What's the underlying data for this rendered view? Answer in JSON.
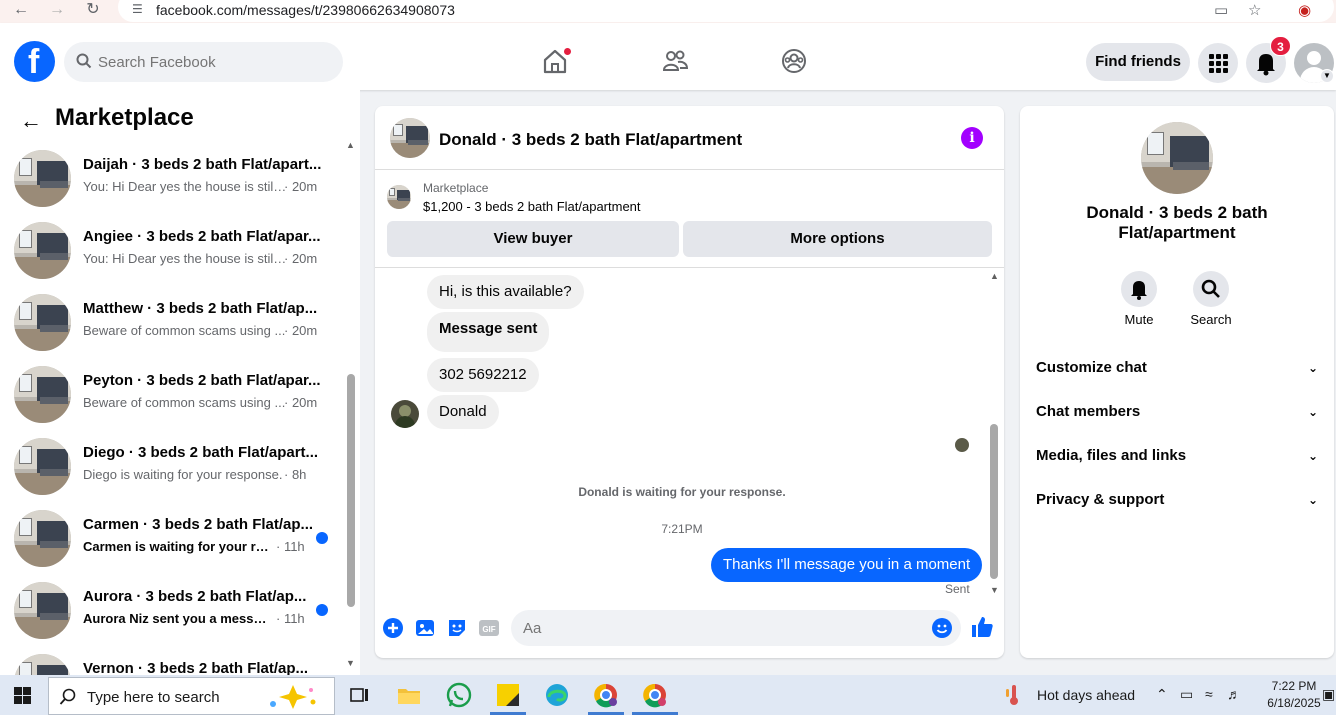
{
  "browser": {
    "url": "facebook.com/messages/t/23980662634908073"
  },
  "header": {
    "logo": "f",
    "search_placeholder": "Search Facebook",
    "find_friends": "Find friends",
    "notification_count": "3"
  },
  "sidebar": {
    "title": "Marketplace",
    "conversations": [
      {
        "name": "Daijah · 3 beds 2 bath Flat/apart...",
        "snippet": "You: Hi Dear yes the house is still ...",
        "time": "· 20m",
        "unread": false
      },
      {
        "name": "Angiee · 3 beds 2 bath Flat/apar...",
        "snippet": "You: Hi Dear yes the house is still ...",
        "time": "· 20m",
        "unread": false
      },
      {
        "name": "Matthew · 3 beds 2 bath Flat/ap...",
        "snippet": "Beware of common scams using ...",
        "time": "· 20m",
        "unread": false
      },
      {
        "name": "Peyton · 3 beds 2 bath Flat/apar...",
        "snippet": "Beware of common scams using ...",
        "time": "· 20m",
        "unread": false
      },
      {
        "name": "Diego · 3 beds 2 bath Flat/apart...",
        "snippet": "Diego is waiting for your response.",
        "time": "· 8h",
        "unread": false
      },
      {
        "name": "Carmen · 3 beds 2 bath Flat/ap...",
        "snippet": "Carmen is waiting for your res...",
        "time": "· 11h",
        "unread": true
      },
      {
        "name": "Aurora · 3 beds 2 bath Flat/ap...",
        "snippet": "Aurora Niz sent you a message...",
        "time": "· 11h",
        "unread": true
      },
      {
        "name": "Vernon · 3 beds 2 bath Flat/ap...",
        "snippet": "",
        "time": "",
        "unread": false
      }
    ]
  },
  "chat": {
    "title": "Donald · 3 beds 2 bath Flat/apartment",
    "listing_source": "Marketplace",
    "listing_price": "$1,200 - 3 beds 2 bath Flat/apartment",
    "view_buyer": "View buyer",
    "more_options": "More options",
    "messages": {
      "m1": "Hi, is this available?",
      "m2": "Message sent",
      "m3": "302 5692212",
      "m4": "Donald",
      "waiting": "Donald is waiting for your response.",
      "timestamp": "7:21PM",
      "outgoing": "Thanks I'll message you in a moment",
      "status": "Sent"
    },
    "input_placeholder": "Aa"
  },
  "info_panel": {
    "name": "Donald · 3 beds 2 bath Flat/apartment",
    "mute": "Mute",
    "search": "Search",
    "sections": [
      "Customize chat",
      "Chat members",
      "Media, files and links",
      "Privacy & support"
    ]
  },
  "taskbar": {
    "search_placeholder": "Type here to search",
    "weather": "Hot days ahead",
    "time": "7:22 PM",
    "date": "6/18/2025"
  },
  "colors": {
    "brand": "#0866ff",
    "badge": "#e41e3f",
    "info": "#a200ff"
  }
}
